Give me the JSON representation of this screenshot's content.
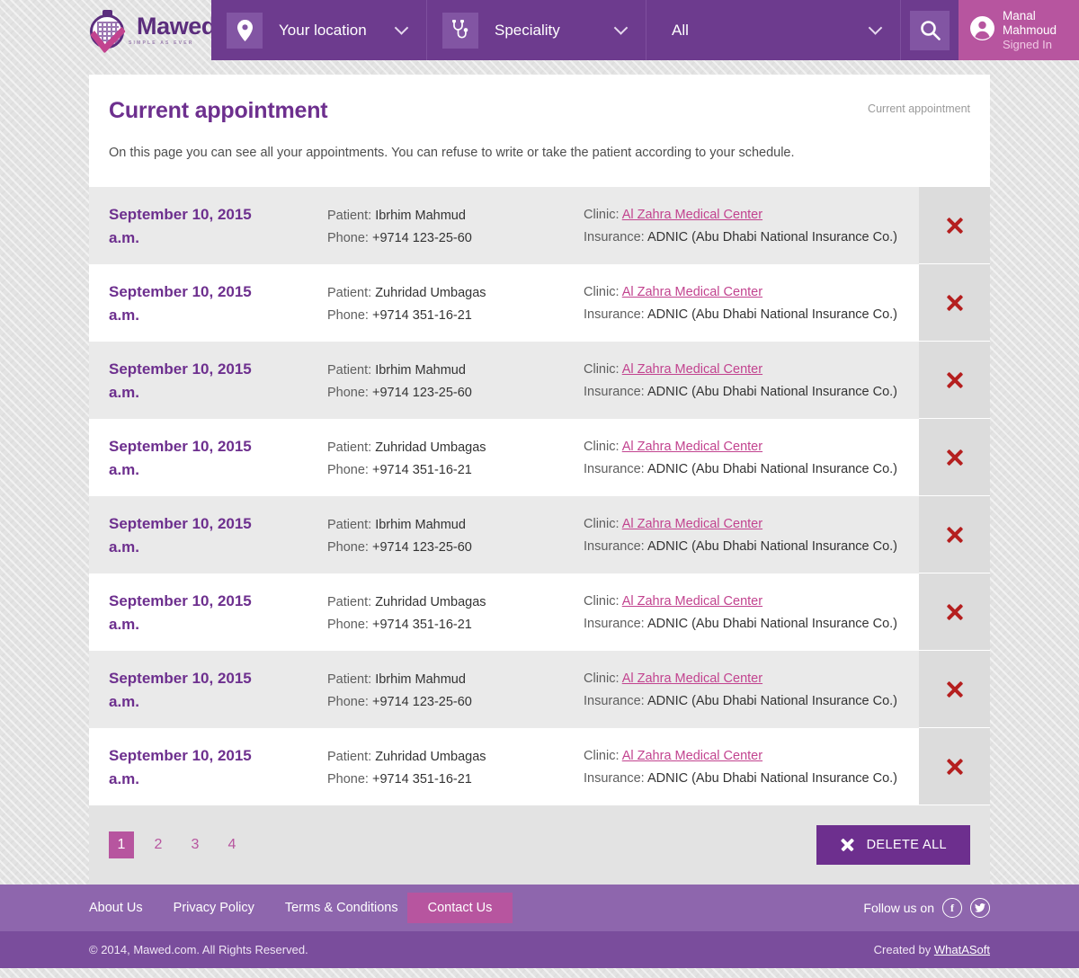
{
  "header": {
    "logo": {
      "name": "Mawed",
      "tagline": "SIMPLE AS EVER"
    },
    "location": {
      "label": "Your location",
      "icon": "map-pin-icon"
    },
    "speciality": {
      "label": "Speciality",
      "icon": "stethoscope-icon"
    },
    "filter_all": {
      "label": "All"
    },
    "search": {
      "icon": "search-icon"
    },
    "user": {
      "name_line1": "Manal",
      "name_line2": "Mahmoud",
      "status": "Signed In",
      "icon": "user-avatar-icon"
    }
  },
  "main": {
    "title": "Current appointment",
    "breadcrumb": "Current appointment",
    "description": "On this page you can see all your appointments. You can refuse to write or take the patient according to your schedule.",
    "labels": {
      "patient": "Patient:",
      "phone": "Phone:",
      "clinic": "Clinic:",
      "insurance": "Insurance:"
    },
    "appointments": [
      {
        "date": "September 10, 2015",
        "time": "a.m.",
        "patient": "Ibrhim Mahmud",
        "phone": "+9714 123-25-60",
        "clinic": "Al Zahra Medical Center",
        "insurance": "ADNIC (Abu Dhabi National Insurance Co.)"
      },
      {
        "date": "September 10, 2015",
        "time": "a.m.",
        "patient": "Zuhridad Umbagas",
        "phone": "+9714 351-16-21",
        "clinic": "Al Zahra Medical Center",
        "insurance": "ADNIC (Abu Dhabi National Insurance Co.)"
      },
      {
        "date": "September 10, 2015",
        "time": "a.m.",
        "patient": "Ibrhim Mahmud",
        "phone": "+9714 123-25-60",
        "clinic": "Al Zahra Medical Center",
        "insurance": "ADNIC (Abu Dhabi National Insurance Co.)"
      },
      {
        "date": "September 10, 2015",
        "time": "a.m.",
        "patient": "Zuhridad Umbagas",
        "phone": "+9714 351-16-21",
        "clinic": "Al Zahra Medical Center",
        "insurance": "ADNIC (Abu Dhabi National Insurance Co.)"
      },
      {
        "date": "September 10, 2015",
        "time": "a.m.",
        "patient": "Ibrhim Mahmud",
        "phone": "+9714 123-25-60",
        "clinic": "Al Zahra Medical Center",
        "insurance": "ADNIC (Abu Dhabi National Insurance Co.)"
      },
      {
        "date": "September 10, 2015",
        "time": "a.m.",
        "patient": "Zuhridad Umbagas",
        "phone": "+9714 351-16-21",
        "clinic": "Al Zahra Medical Center",
        "insurance": "ADNIC (Abu Dhabi National Insurance Co.)"
      },
      {
        "date": "September 10, 2015",
        "time": "a.m.",
        "patient": "Ibrhim Mahmud",
        "phone": "+9714 123-25-60",
        "clinic": "Al Zahra Medical Center",
        "insurance": "ADNIC (Abu Dhabi National Insurance Co.)"
      },
      {
        "date": "September 10, 2015",
        "time": "a.m.",
        "patient": "Zuhridad Umbagas",
        "phone": "+9714 351-16-21",
        "clinic": "Al Zahra Medical Center",
        "insurance": "ADNIC (Abu Dhabi National Insurance Co.)"
      }
    ],
    "pagination": {
      "pages": [
        "1",
        "2",
        "3",
        "4"
      ],
      "active": "1"
    },
    "delete_all": {
      "label": "DELETE ALL",
      "icon": "close-x-icon"
    },
    "row_delete_icon": "close-x-icon"
  },
  "footer": {
    "links": [
      "About Us",
      "Privacy Policy",
      "Terms & Conditions"
    ],
    "contact": "Contact Us",
    "follow_label": "Follow us on",
    "social": [
      {
        "name": "facebook-icon",
        "glyph": "f"
      },
      {
        "name": "twitter-icon",
        "glyph": "ᵛ"
      }
    ],
    "copyright": "© 2014, Mawed.com. All Rights Reserved.",
    "credit_prefix": "Created by ",
    "credit_link": "WhatASoft"
  },
  "colors": {
    "purple_dark": "#6d2f8e",
    "purple_bar": "#6d3b8e",
    "pink": "#b7559f",
    "link_pink": "#c2438f",
    "delete_red": "#b51f1f",
    "footer_top": "#8e66ad",
    "footer_bottom": "#7a4d9c"
  }
}
